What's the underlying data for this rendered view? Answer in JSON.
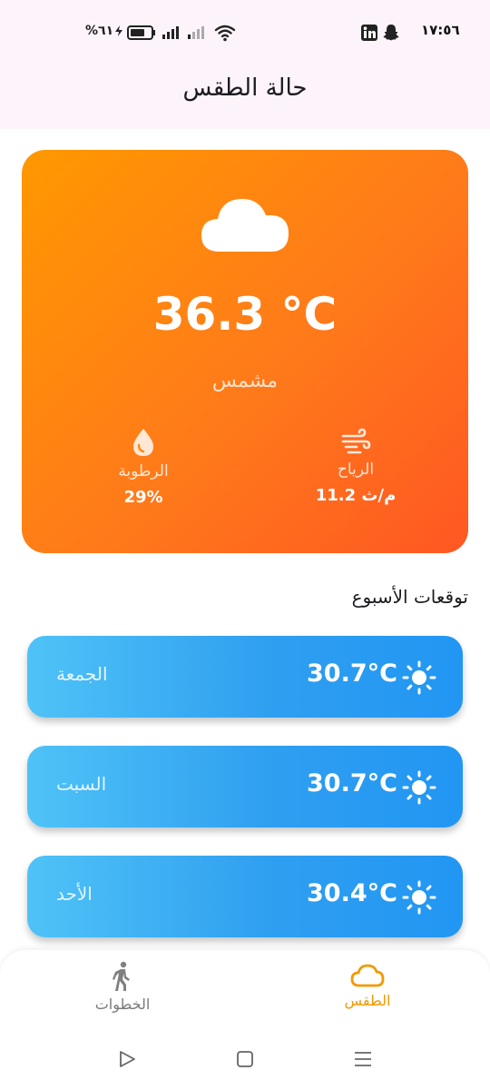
{
  "status_bar": {
    "time": "١٧:٥٦",
    "battery_text": "%٦١"
  },
  "header": {
    "title": "حالة الطقس"
  },
  "current": {
    "icon": "cloud-icon",
    "temperature": "36.3 °C",
    "condition": "مشمس",
    "humidity_label": "الرطوبة",
    "humidity_value": "29%",
    "wind_label": "الرياح",
    "wind_value": "11.2 م/ث"
  },
  "forecast": {
    "title": "توقعات الأسبوع",
    "days": [
      {
        "day": "الجمعة",
        "temp": "30.7°C",
        "icon": "sun-icon"
      },
      {
        "day": "السبت",
        "temp": "30.7°C",
        "icon": "sun-icon"
      },
      {
        "day": "الأحد",
        "temp": "30.4°C",
        "icon": "sun-icon"
      }
    ]
  },
  "bottom_nav": {
    "items": [
      {
        "label": "الخطوات",
        "icon": "walking-icon",
        "active": false
      },
      {
        "label": "الطقس",
        "icon": "cloud-icon",
        "active": true
      }
    ]
  },
  "colors": {
    "hero_start": "#ff9800",
    "hero_end": "#ff5722",
    "card_start": "#4fc3f7",
    "card_end": "#2196f3",
    "active_nav": "#f29a00"
  }
}
